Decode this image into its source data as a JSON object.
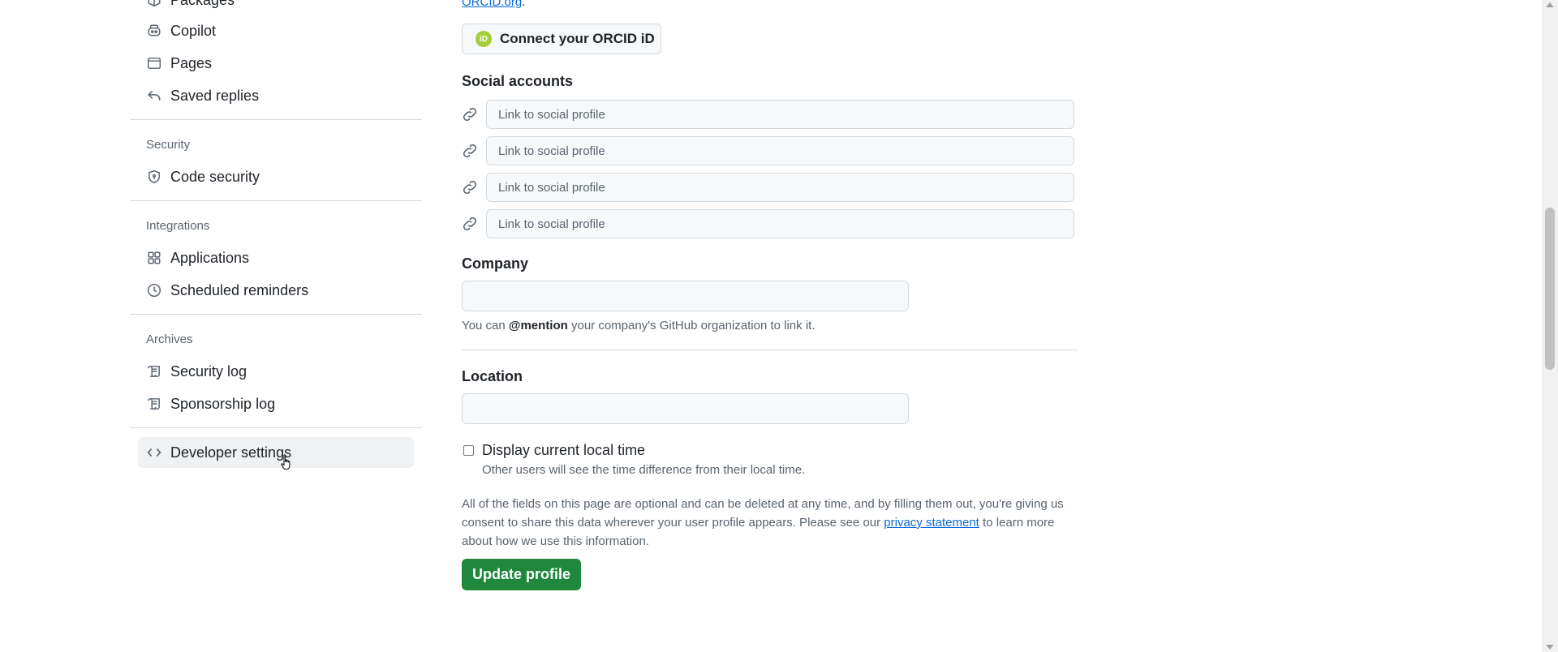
{
  "sidebar": {
    "top_items": [
      {
        "label": "Packages",
        "icon": "package-icon"
      },
      {
        "label": "Copilot",
        "icon": "copilot-icon"
      },
      {
        "label": "Pages",
        "icon": "browser-icon"
      },
      {
        "label": "Saved replies",
        "icon": "reply-icon"
      }
    ],
    "security": {
      "heading": "Security",
      "items": [
        {
          "label": "Code security",
          "icon": "shield-lock-icon"
        }
      ]
    },
    "integrations": {
      "heading": "Integrations",
      "items": [
        {
          "label": "Applications",
          "icon": "apps-icon"
        },
        {
          "label": "Scheduled reminders",
          "icon": "clock-icon"
        }
      ]
    },
    "archives": {
      "heading": "Archives",
      "items": [
        {
          "label": "Security log",
          "icon": "log-icon"
        },
        {
          "label": "Sponsorship log",
          "icon": "log-icon"
        }
      ]
    },
    "developer": {
      "label": "Developer settings",
      "icon": "code-icon"
    }
  },
  "main": {
    "orcid_link": "ORCID.org",
    "orcid_link_suffix": ".",
    "orcid_button": "Connect your ORCID iD",
    "orcid_badge": "iD",
    "social_heading": "Social accounts",
    "social_placeholder": "Link to social profile",
    "company_heading": "Company",
    "company_value": "",
    "company_note_pre": "You can ",
    "company_note_bold": "@mention",
    "company_note_post": " your company's GitHub organization to link it.",
    "location_heading": "Location",
    "location_value": "",
    "local_time_label": "Display current local time",
    "local_time_checked": false,
    "local_time_note": "Other users will see the time difference from their local time.",
    "disclaimer_pre": "All of the fields on this page are optional and can be deleted at any time, and by filling them out, you're giving us consent to share this data wherever your user profile appears. Please see our ",
    "disclaimer_link": "privacy statement",
    "disclaimer_post": " to learn more about how we use this information.",
    "update_button": "Update profile"
  },
  "colors": {
    "primary_button": "#1f883d",
    "link": "#0969da",
    "active_nav_bg": "#eff1f3",
    "orcid_green": "#a6ce39"
  }
}
